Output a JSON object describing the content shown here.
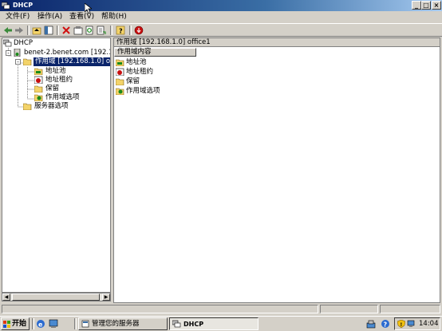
{
  "window": {
    "title": "DHCP"
  },
  "menu": [
    "文件(F)",
    "操作(A)",
    "查看(V)",
    "帮助(H)"
  ],
  "tree": {
    "root": "DHCP",
    "server": "benet-2.benet.com [192.168",
    "scope": "作用域 [192.168.1.0] o",
    "scope_children": [
      "地址池",
      "地址租约",
      "保留",
      "作用域选项"
    ],
    "server_options": "服务器选项"
  },
  "right": {
    "path": "作用域 [192.168.1.0] office1",
    "column_header": "作用域内容",
    "items": [
      "地址池",
      "地址租约",
      "保留",
      "作用域选项"
    ]
  },
  "taskbar": {
    "start": "开始",
    "tasks": [
      "管理您的服务器",
      "DHCP"
    ],
    "clock": "14:04"
  },
  "colors": {
    "title_start": "#0a246a",
    "title_end": "#a6caf0",
    "selection": "#0a246a",
    "chrome": "#d4d0c8"
  }
}
